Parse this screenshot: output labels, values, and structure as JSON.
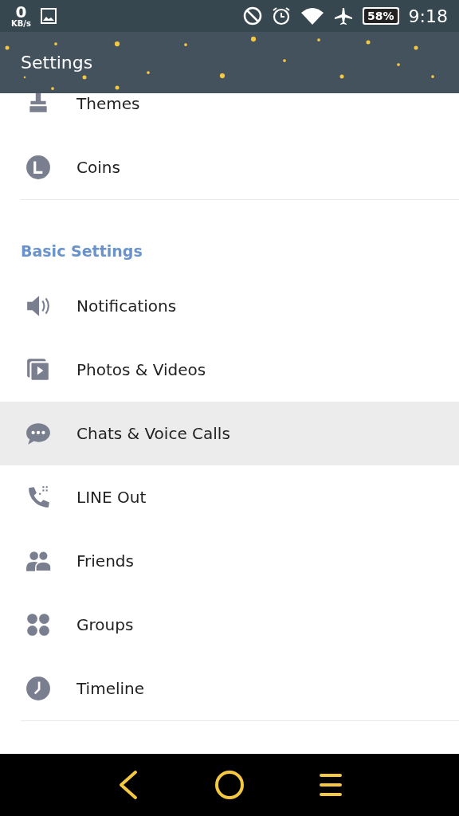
{
  "status_bar": {
    "speed_value": "0",
    "speed_unit": "KB/s",
    "battery": "58%",
    "time": "9:18"
  },
  "app_bar": {
    "title": "Settings"
  },
  "top_items": [
    {
      "label": "Themes",
      "selected": false
    },
    {
      "label": "Coins",
      "selected": false
    }
  ],
  "section": {
    "title": "Basic Settings",
    "items": [
      {
        "label": "Notifications",
        "selected": false
      },
      {
        "label": "Photos & Videos",
        "selected": false
      },
      {
        "label": "Chats & Voice Calls",
        "selected": true
      },
      {
        "label": "LINE Out",
        "selected": false
      },
      {
        "label": "Friends",
        "selected": false
      },
      {
        "label": "Groups",
        "selected": false
      },
      {
        "label": "Timeline",
        "selected": false
      }
    ]
  }
}
